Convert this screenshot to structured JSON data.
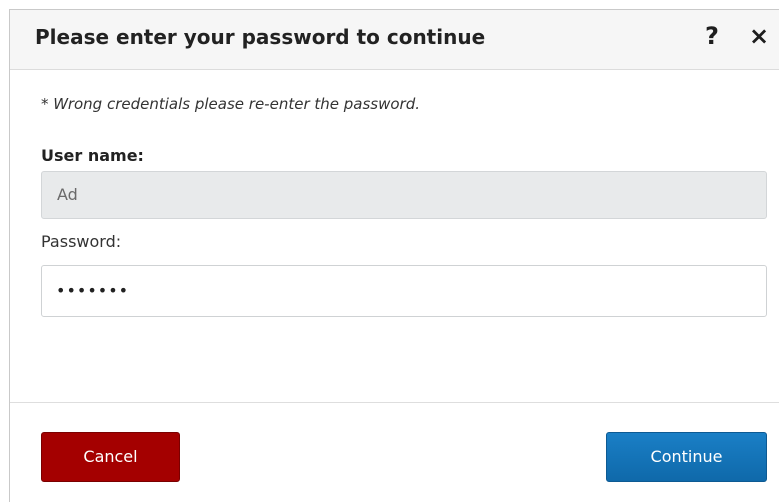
{
  "dialog": {
    "title": "Please enter your password to continue",
    "help_icon": "?",
    "close_icon": "×",
    "error_message": "* Wrong credentials please re-enter the password.",
    "username_label": "User name:",
    "username_value": "Ad",
    "password_label": "Password:",
    "password_value": "•••••••",
    "cancel_label": "Cancel",
    "continue_label": "Continue"
  },
  "colors": {
    "header_bg": "#f6f6f6",
    "cancel_bg": "#a40000",
    "continue_bg": "#1274b9",
    "readonly_input_bg": "#e8eaeb"
  },
  "icons": {
    "help": "help-icon",
    "close": "close-icon"
  }
}
